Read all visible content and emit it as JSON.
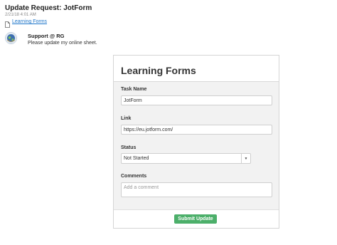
{
  "header": {
    "title": "Update Request: JotForm",
    "date": "2/21/18 4:01 AM",
    "sheet_link": "Learning Forms",
    "sheet_icon": "document-icon"
  },
  "message": {
    "avatar_icon": "globe-avatar-icon",
    "sender": "Support @ RG",
    "body": "Please update my online sheet."
  },
  "form": {
    "title": "Learning Forms",
    "fields": {
      "task_name": {
        "label": "Task Name",
        "value": "JotForm"
      },
      "link": {
        "label": "Link",
        "value": "https://eu.jotform.com/"
      },
      "status": {
        "label": "Status",
        "value": "Not Started"
      },
      "comments": {
        "label": "Comments",
        "placeholder": "Add a comment"
      }
    },
    "submit_label": "Submit Update"
  },
  "colors": {
    "link": "#1a73c8",
    "submit": "#4caf6a",
    "form_background": "#f2f2f2"
  }
}
